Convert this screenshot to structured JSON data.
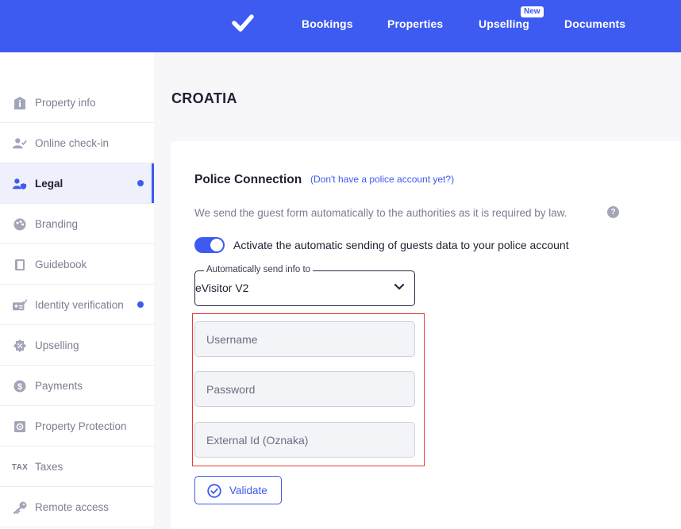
{
  "topbar": {
    "logo_icon": "checkmark-icon",
    "nav": [
      {
        "label": "Bookings"
      },
      {
        "label": "Properties"
      },
      {
        "label": "Upselling",
        "badge": "New"
      },
      {
        "label": "Documents"
      }
    ]
  },
  "sidebar": {
    "items": [
      {
        "label": "Property info",
        "icon": "info-icon"
      },
      {
        "label": "Online check-in",
        "icon": "user-check-icon"
      },
      {
        "label": "Legal",
        "icon": "user-shield-icon",
        "active": true,
        "dot": true
      },
      {
        "label": "Branding",
        "icon": "palette-icon"
      },
      {
        "label": "Guidebook",
        "icon": "book-icon"
      },
      {
        "label": "Identity verification",
        "icon": "id-card-icon",
        "dot": true
      },
      {
        "label": "Upselling",
        "icon": "percent-badge-icon"
      },
      {
        "label": "Payments",
        "icon": "dollar-icon"
      },
      {
        "label": "Property Protection",
        "icon": "safe-icon"
      },
      {
        "label": "Taxes",
        "icon": "tax-icon",
        "icon_text": "TAX"
      },
      {
        "label": "Remote access",
        "icon": "key-icon"
      }
    ]
  },
  "main": {
    "page_title": "CROATIA",
    "police": {
      "title": "Police Connection",
      "link": "(Don't have a police account yet?)",
      "description": "We send the guest form automatically to the authorities as it is required by law.",
      "help_icon": "?",
      "toggle_on": true,
      "toggle_label": "Activate the automatic sending of guests data to your police account",
      "select_legend": "Automatically send info to",
      "select_value": "eVisitor V2",
      "fields": {
        "username_placeholder": "Username",
        "password_placeholder": "Password",
        "external_id_placeholder": "External Id (Oznaka)"
      },
      "validate_label": "Validate"
    }
  },
  "colors": {
    "brand": "#3d5af1",
    "highlight_border": "#e53935"
  }
}
